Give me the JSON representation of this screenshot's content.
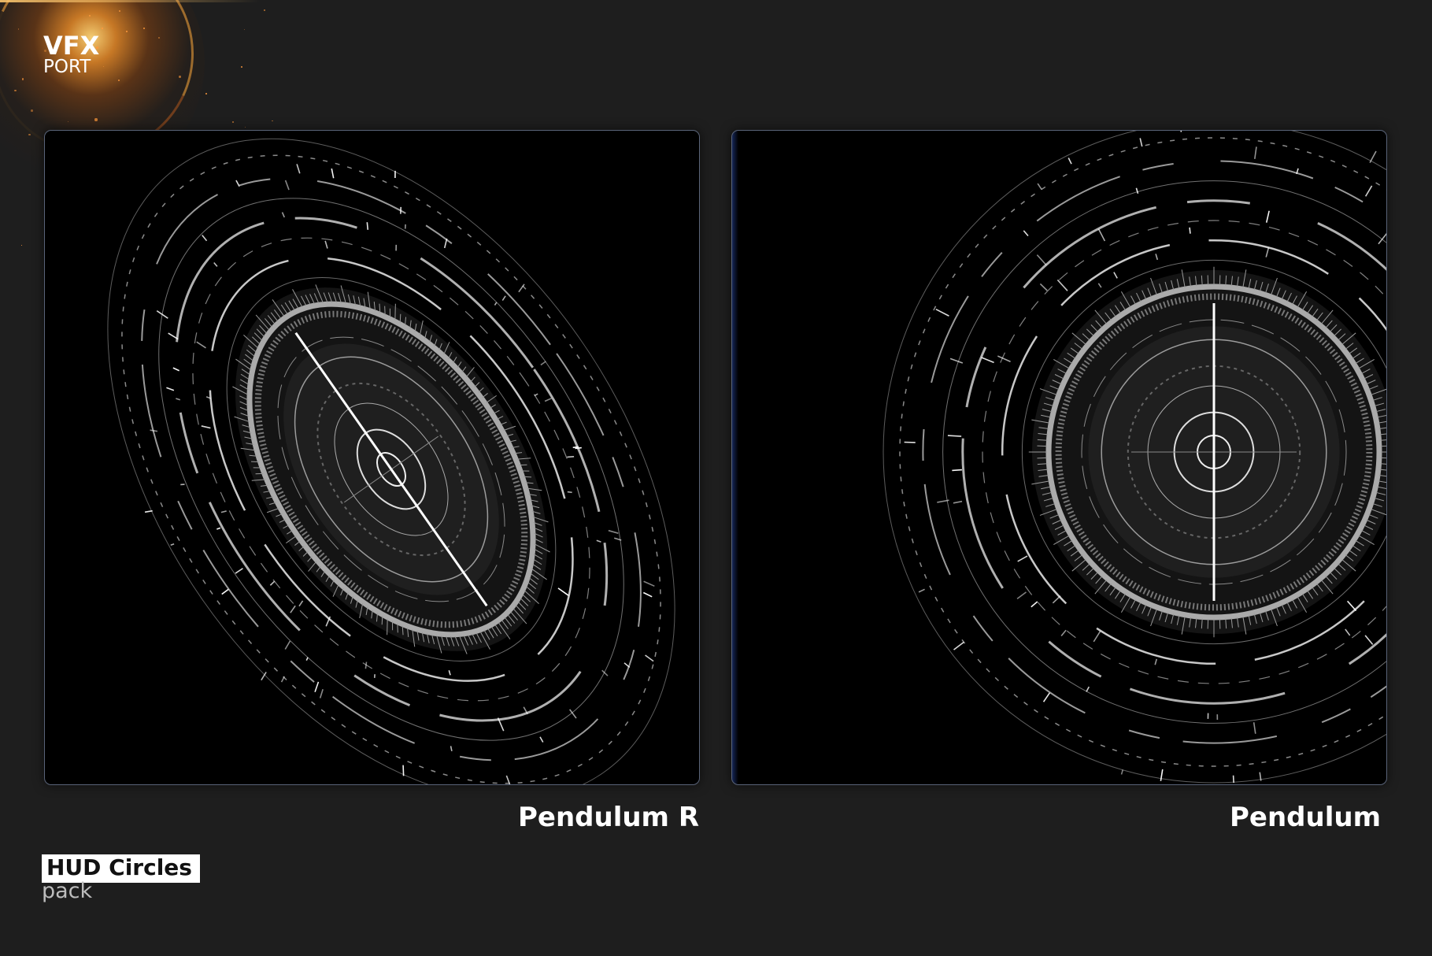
{
  "logo": {
    "line1": "VFX",
    "line2": "PORT"
  },
  "previews": [
    {
      "caption": "Pendulum R",
      "graphic": "hud-circle-tilted"
    },
    {
      "caption": "Pendulum",
      "graphic": "hud-circle-frontal"
    }
  ],
  "brand": {
    "name": "HUD Circles",
    "subtitle": "pack"
  },
  "colors": {
    "background": "#1e1e1e",
    "panel": "#000000",
    "panel_border": "#5a6479",
    "glow": "#ff9a3c",
    "text": "#ffffff"
  }
}
